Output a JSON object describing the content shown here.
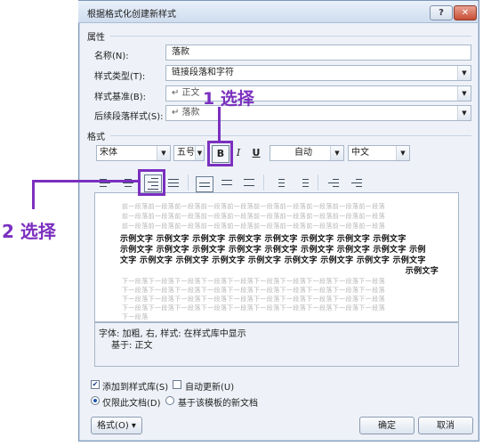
{
  "dialog": {
    "title": "根据格式化创建新样式",
    "help": "?",
    "close": "✕"
  },
  "properties": {
    "section": "属性",
    "name_label": "名称(N):",
    "name_value": "落款",
    "type_label": "样式类型(T):",
    "type_value": "链接段落和字符",
    "base_label": "样式基准(B):",
    "base_value": "↵ 正文",
    "next_label": "后续段落样式(S):",
    "next_value": "↵ 落款"
  },
  "format": {
    "section": "格式",
    "font": "宋体",
    "size": "五号",
    "bold": "B",
    "italic": "I",
    "underline": "U",
    "color": "自动",
    "lang": "中文"
  },
  "preview": {
    "prev_para": [
      "前一段落前一段落前一段落前一段落前一段落前一段落前一段落前一段落前一段落前一段落",
      "前一段落前一段落前一段落前一段落前一段落前一段落前一段落前一段落前一段落前一段落",
      "前一段落前一段落前一段落前一段落前一段落前一段落前一段落前一段落前一段落前一段落"
    ],
    "sample": [
      "示例文字 示例文字 示例文字 示例文字 示例文字 示例文字 示例文字 示例文字",
      "示例文字 示例文字 示例文字 示例文字 示例文字 示例文字 示例文字 示例文字 示例",
      "文字 示例文字 示例文字 示例文字 示例文字 示例文字 示例文字 示例文字 示例文字",
      "示例文字"
    ],
    "next_para": [
      "下一段落下一段落下一段落下一段落下一段落下一段落下一段落下一段落下一段落下一段落",
      "下一段落下一段落下一段落下一段落下一段落下一段落下一段落下一段落下一段落下一段落",
      "下一段落下一段落下一段落下一段落下一段落下一段落下一段落下一段落下一段落下一段落",
      "下一段落下一段落下一段落下一段落下一段落下一段落下一段落下一段落下一段落下一段落",
      "下一段落"
    ]
  },
  "description": {
    "line1": "字体: 加粗, 右, 样式: 在样式库中显示",
    "line2": "基于: 正文"
  },
  "options": {
    "add_to_gallery": "添加到样式库(S)",
    "auto_update": "自动更新(U)",
    "only_this_doc": "仅限此文档(D)",
    "new_docs_template": "基于该模板的新文档"
  },
  "buttons": {
    "format": "格式(O) ▾",
    "ok": "确定",
    "cancel": "取消"
  },
  "annotations": {
    "step1": "1 选择",
    "step2": "2 选择",
    "color": "#7b2fbf"
  }
}
